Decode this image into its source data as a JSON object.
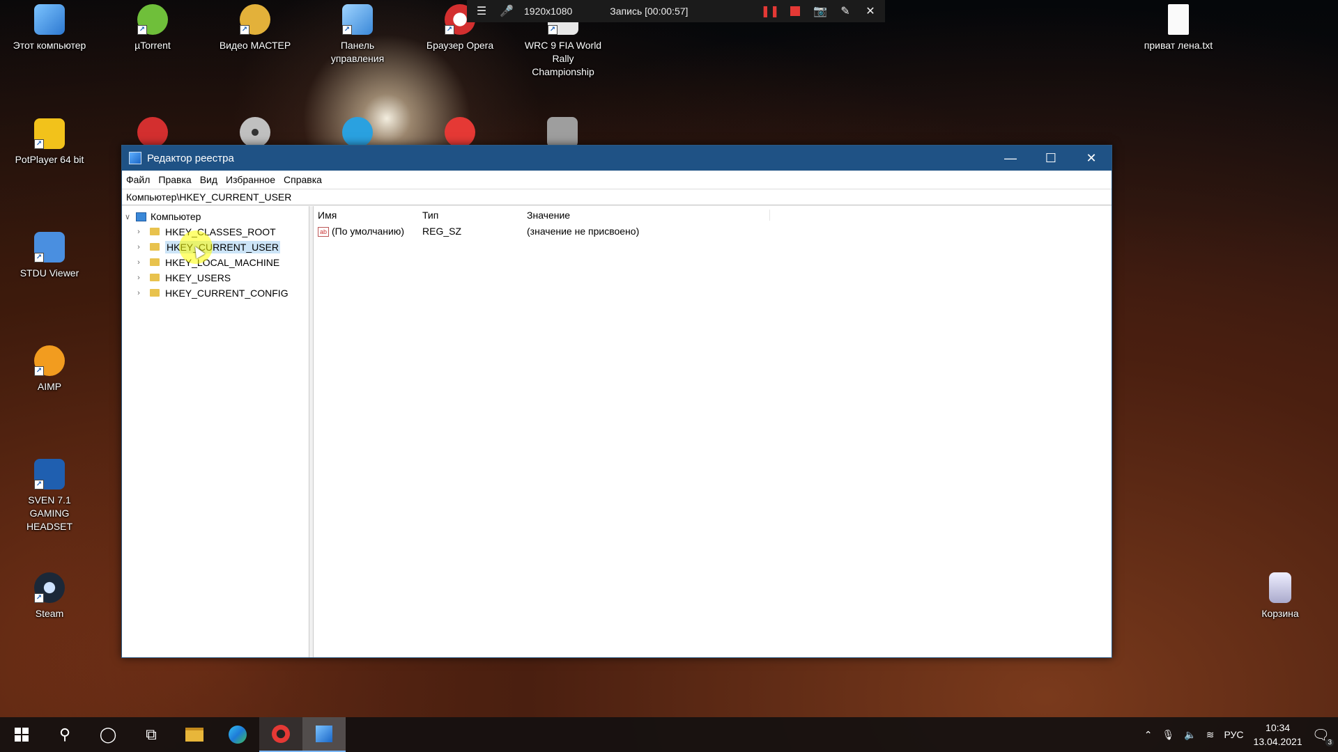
{
  "desktop": {
    "icons_top": [
      {
        "label": "Этот компьютер",
        "color": "#3a8ee6"
      },
      {
        "label": "µTorrent",
        "color": "#6fbf3a"
      },
      {
        "label": "Видео МАСТЕР",
        "color": "#e3b13a"
      },
      {
        "label": "Панель управления",
        "color": "#4aa3e8"
      },
      {
        "label": "Браузер Opera",
        "color": "#d32f2f"
      },
      {
        "label": "WRC 9 FIA World Rally Championship",
        "color": "#e8e8e8"
      }
    ],
    "icon_top_right": {
      "label": "приват лена.txt"
    },
    "icons_row2": [
      {
        "label": "",
        "color": "#d32f2f"
      },
      {
        "label": "",
        "color": "#c0c0c0"
      },
      {
        "label": "",
        "color": "#2aa1e0"
      },
      {
        "label": "",
        "color": "#e53935"
      },
      {
        "label": "",
        "color": "#9e9e9e"
      }
    ],
    "icons_left": [
      {
        "label": "PotPlayer 64 bit",
        "color": "#f2c21b"
      },
      {
        "label": "STDU Viewer",
        "color": "#4a8fe0"
      },
      {
        "label": "AIMP",
        "color": "#f29c1f"
      },
      {
        "label": "SVEN 7.1 GAMING HEADSET",
        "color": "#1f5fb0"
      },
      {
        "label": "Steam",
        "color": "#1b2838"
      }
    ],
    "recycle_bin": {
      "label": "Корзина"
    }
  },
  "recording_bar": {
    "resolution": "1920x1080",
    "title": "Запись [00:00:57]"
  },
  "window": {
    "title": "Редактор реестра",
    "menu": [
      "Файл",
      "Правка",
      "Вид",
      "Избранное",
      "Справка"
    ],
    "address": "Компьютер\\HKEY_CURRENT_USER",
    "tree": {
      "root": "Компьютер",
      "children": [
        "HKEY_CLASSES_ROOT",
        "HKEY_CURRENT_USER",
        "HKEY_LOCAL_MACHINE",
        "HKEY_USERS",
        "HKEY_CURRENT_CONFIG"
      ],
      "selected": "HKEY_CURRENT_USER"
    },
    "columns": [
      "Имя",
      "Тип",
      "Значение"
    ],
    "rows": [
      {
        "name": "(По умолчанию)",
        "type": "REG_SZ",
        "value": "(значение не присвоено)"
      }
    ]
  },
  "taskbar": {
    "language": "РУС",
    "time": "10:34",
    "date": "13.04.2021",
    "notification_count": "3"
  }
}
